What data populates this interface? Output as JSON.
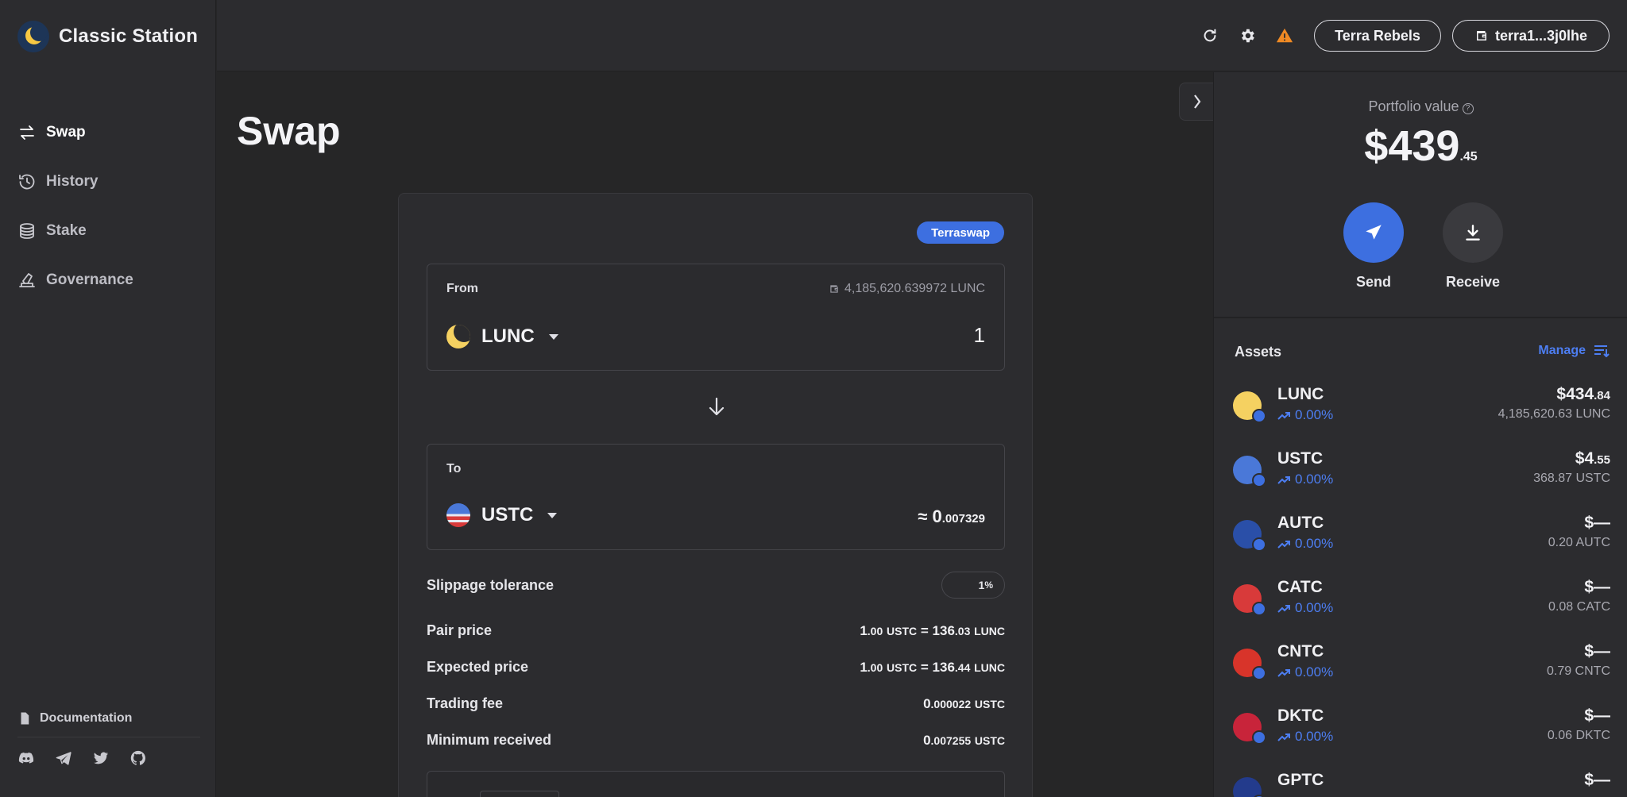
{
  "app": {
    "title": "Classic Station"
  },
  "sidebar": {
    "items": [
      {
        "label": "Swap",
        "icon": "swap-icon",
        "active": true
      },
      {
        "label": "History",
        "icon": "history-icon",
        "active": false
      },
      {
        "label": "Stake",
        "icon": "stake-icon",
        "active": false
      },
      {
        "label": "Governance",
        "icon": "governance-icon",
        "active": false
      }
    ],
    "documentation": "Documentation",
    "socials": [
      "discord-icon",
      "telegram-icon",
      "twitter-icon",
      "github-icon"
    ]
  },
  "header": {
    "network_button": "Terra Rebels",
    "wallet_button": "terra1...3j0lhe",
    "icons": [
      "refresh-icon",
      "settings-icon",
      "warning-icon"
    ]
  },
  "page": {
    "title": "Swap"
  },
  "swap": {
    "badge": "Terraswap",
    "from": {
      "label": "From",
      "balance": "4,185,620.639972 LUNC",
      "token": "LUNC",
      "amount": "1"
    },
    "to": {
      "label": "To",
      "token": "USTC",
      "amount_prefix": "≈ 0",
      "amount_decimals": ".007329"
    },
    "slippage": {
      "label": "Slippage tolerance",
      "value": "1",
      "unit": "%"
    },
    "pair_price": {
      "label": "Pair price",
      "a_int": "1",
      "a_dec": ".00",
      "a_unit": "USTC",
      "eq": "=",
      "b_int": "136",
      "b_dec": ".03",
      "b_unit": "LUNC"
    },
    "expected_price": {
      "label": "Expected price",
      "a_int": "1",
      "a_dec": ".00",
      "a_unit": "USTC",
      "eq": "=",
      "b_int": "136",
      "b_dec": ".44",
      "b_unit": "LUNC"
    },
    "trading_fee": {
      "label": "Trading fee",
      "int": "0",
      "dec": ".000022",
      "unit": "USTC"
    },
    "minimum_received": {
      "label": "Minimum received",
      "int": "0",
      "dec": ".007255",
      "unit": "USTC"
    }
  },
  "portfolio": {
    "label": "Portfolio value",
    "value_int": "$439",
    "value_dec": ".45",
    "send": "Send",
    "receive": "Receive"
  },
  "assets": {
    "title": "Assets",
    "manage": "Manage",
    "items": [
      {
        "name": "LUNC",
        "change": "0.00%",
        "value_int": "$434",
        "value_dec": ".84",
        "balance": "4,185,620.63 LUNC",
        "color": "#f5d161"
      },
      {
        "name": "USTC",
        "change": "0.00%",
        "value_int": "$4",
        "value_dec": ".55",
        "balance": "368.87 USTC",
        "color": "#4a78d8"
      },
      {
        "name": "AUTC",
        "change": "0.00%",
        "value_int": "$—",
        "value_dec": "",
        "balance": "0.20 AUTC",
        "color": "#2a4fa8"
      },
      {
        "name": "CATC",
        "change": "0.00%",
        "value_int": "$—",
        "value_dec": "",
        "balance": "0.08 CATC",
        "color": "#d83a3a"
      },
      {
        "name": "CNTC",
        "change": "0.00%",
        "value_int": "$—",
        "value_dec": "",
        "balance": "0.79 CNTC",
        "color": "#d8342a"
      },
      {
        "name": "DKTC",
        "change": "0.00%",
        "value_int": "$—",
        "value_dec": "",
        "balance": "0.06 DKTC",
        "color": "#c8243a"
      },
      {
        "name": "GPTC",
        "change": "",
        "value_int": "$—",
        "value_dec": "",
        "balance": "",
        "color": "#233b8c"
      }
    ]
  },
  "colors": {
    "accent": "#3d6fe0",
    "warning": "#f08a24",
    "background": "#262627",
    "panel": "#2c2c2f"
  }
}
